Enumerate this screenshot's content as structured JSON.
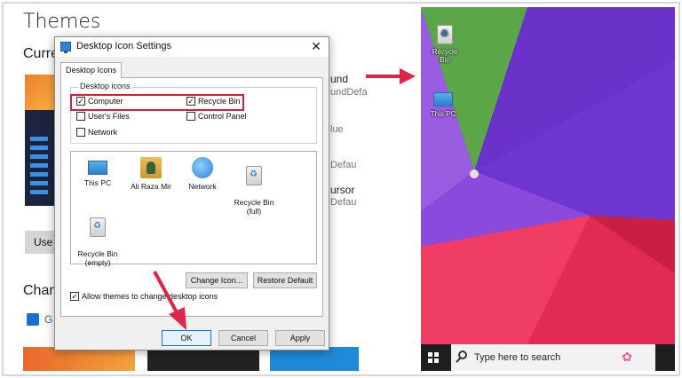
{
  "settings": {
    "title": "Themes",
    "current_partial": "Curre",
    "use_button_partial": "Use",
    "change_partial": "Chan",
    "store_partial": "G",
    "right_items": [
      {
        "text": "und",
        "dark": true
      },
      {
        "text": "undDefa",
        "dark": false
      },
      {
        "text": "lue",
        "dark": false
      },
      {
        "text": "Defau",
        "dark": false
      },
      {
        "text": "ursor",
        "dark": true
      },
      {
        "text": "Defau",
        "dark": false
      }
    ]
  },
  "dialog": {
    "title": "Desktop Icon Settings",
    "close_glyph": "✕",
    "tab_label": "Desktop Icons",
    "group_label": "Desktop icons",
    "checkboxes": [
      {
        "label": "Computer",
        "checked": true
      },
      {
        "label": "Recycle Bin",
        "checked": true
      },
      {
        "label": "User's Files",
        "checked": false
      },
      {
        "label": "Control Panel",
        "checked": false
      },
      {
        "label": "Network",
        "checked": false
      }
    ],
    "icons": [
      {
        "label": "This PC",
        "icon": "computer-icon"
      },
      {
        "label": "Ali Raza Mir",
        "icon": "user-folder-icon"
      },
      {
        "label": "Network",
        "icon": "network-icon"
      },
      {
        "label": "Recycle Bin\n(full)",
        "icon": "recycle-bin-full-icon"
      },
      {
        "label": "Recycle Bin\n(empty)",
        "icon": "recycle-bin-empty-icon"
      }
    ],
    "change_icon_label": "Change Icon...",
    "restore_default_label": "Restore Default",
    "allow_themes_label": "Allow themes to change desktop icons",
    "allow_themes_checked": true,
    "ok_label": "OK",
    "cancel_label": "Cancel",
    "apply_label": "Apply"
  },
  "desktop": {
    "icons": [
      {
        "label": "Recycle Bin",
        "icon": "recycle-bin-icon"
      },
      {
        "label": "This PC",
        "icon": "computer-icon"
      }
    ],
    "taskbar": {
      "search_placeholder": "Type here to search"
    }
  },
  "colors": {
    "highlight": "#d21f3c",
    "arrow": "#e0254a",
    "accent": "#0078d7"
  }
}
